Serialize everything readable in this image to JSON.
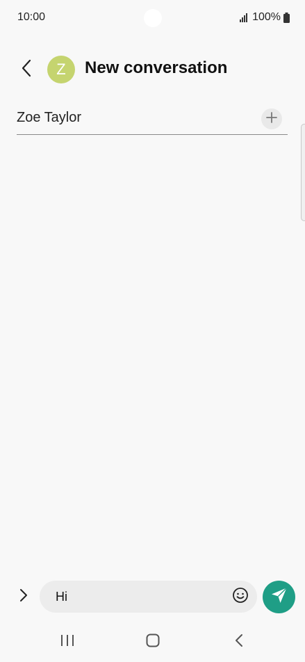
{
  "status_bar": {
    "time": "10:00",
    "battery_text": "100%",
    "icons": [
      "signal-icon",
      "battery-icon"
    ]
  },
  "header": {
    "back_icon": "chevron-left-icon",
    "avatar_initial": "Z",
    "title": "New conversation"
  },
  "recipient": {
    "value": "Zoe Taylor",
    "add_icon": "plus-icon"
  },
  "composer": {
    "expand_icon": "chevron-right-icon",
    "message_value": "Hi",
    "emoji_icon": "smiley-icon",
    "send_icon": "send-icon"
  },
  "navigation": {
    "items": [
      "recents-icon",
      "home-icon",
      "back-icon"
    ]
  },
  "colors": {
    "background": "#f8f8f8",
    "avatar": "#c5d46f",
    "send_button": "#1f9e86",
    "message_box": "#ececec"
  }
}
